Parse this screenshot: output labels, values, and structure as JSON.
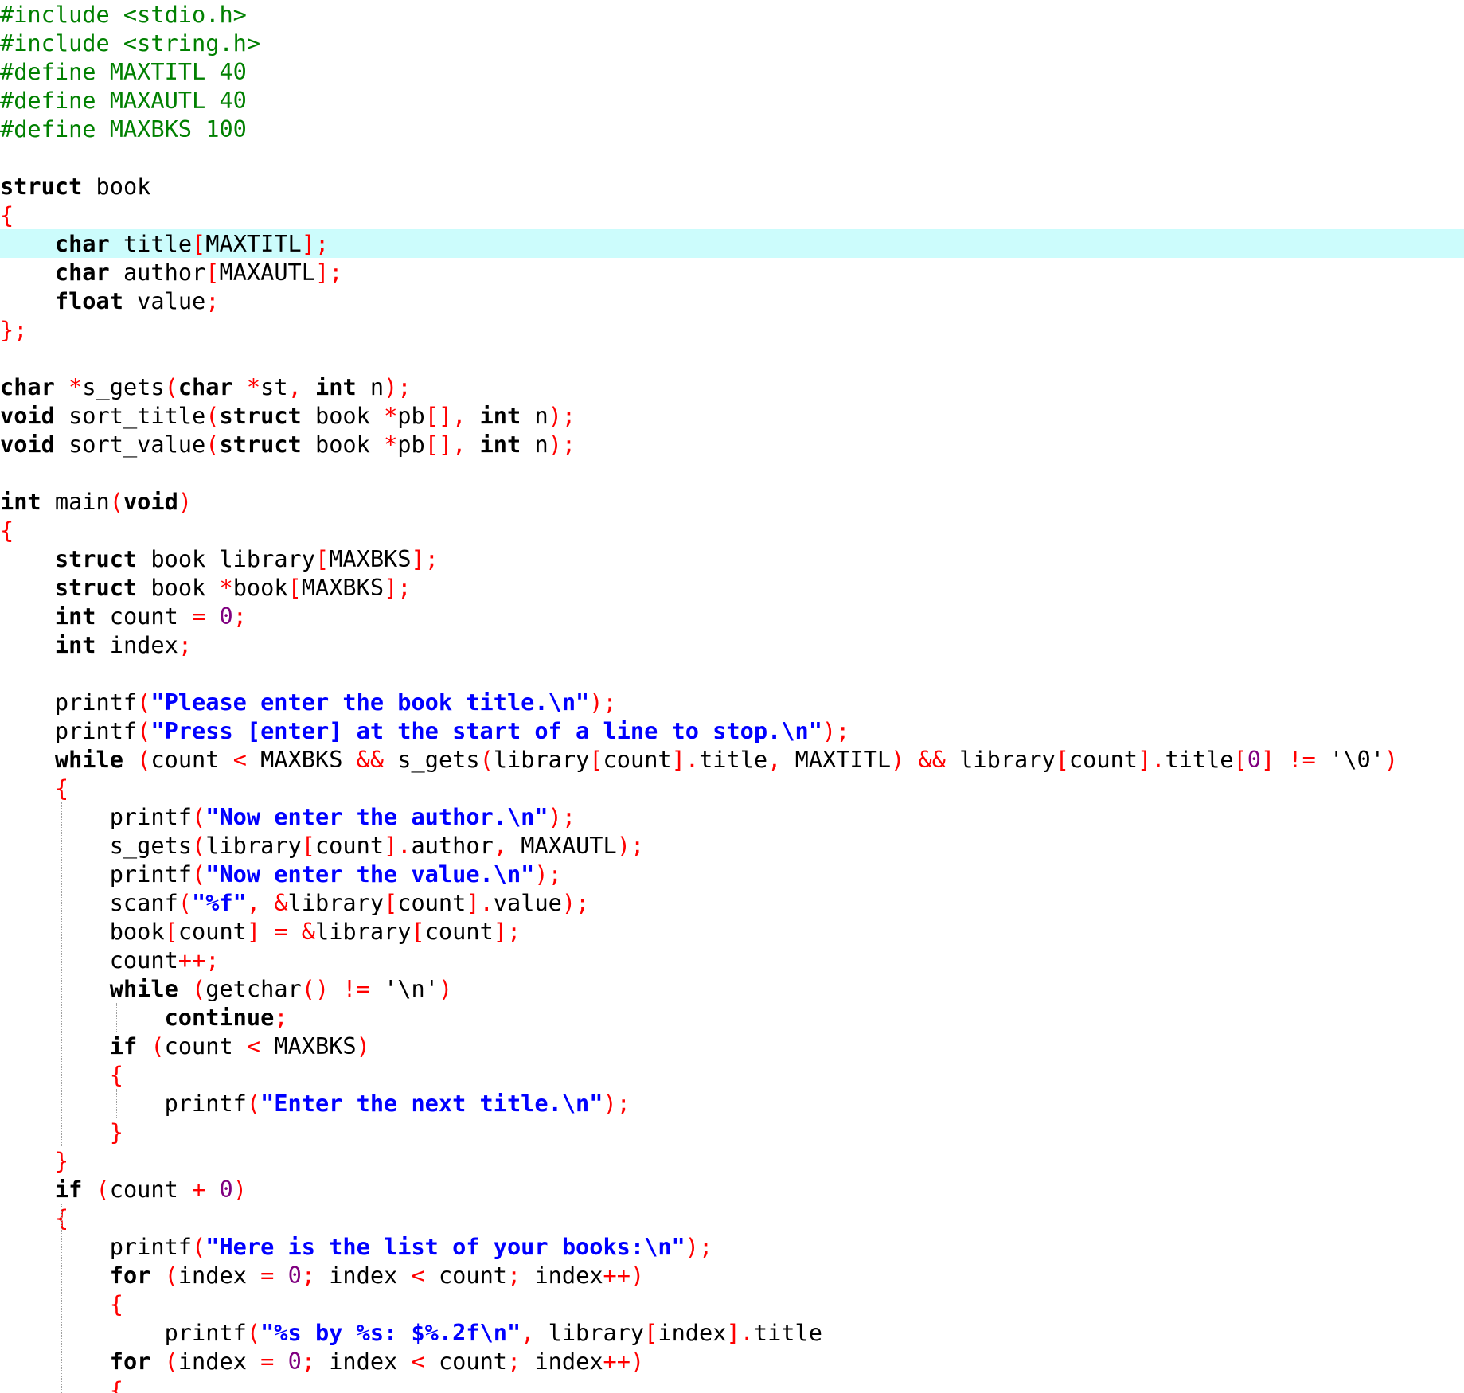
{
  "editor": {
    "current_line_index": 8,
    "colors": {
      "keyword": "#000000",
      "preprocessor": "#008000",
      "operator": "#ff0000",
      "string": "#0000ff",
      "number": "#800080",
      "current_line_highlight": "#ccfcfc"
    },
    "lines": [
      [
        [
          "#include <stdio.h>",
          "pp"
        ]
      ],
      [
        [
          "#include <string.h>",
          "pp"
        ]
      ],
      [
        [
          "#define MAXTITL 40",
          "pp"
        ]
      ],
      [
        [
          "#define MAXAUTL 40",
          "pp"
        ]
      ],
      [
        [
          "#define MAXBKS 100",
          "pp"
        ]
      ],
      [],
      [
        [
          "struct",
          "kw"
        ],
        [
          " book",
          ""
        ]
      ],
      [
        [
          "{",
          "op"
        ]
      ],
      [
        [
          "    ",
          ""
        ],
        [
          "char",
          "kw"
        ],
        [
          " title",
          ""
        ],
        [
          "[",
          "op"
        ],
        [
          "MAXTITL",
          ""
        ],
        [
          "];",
          "op"
        ]
      ],
      [
        [
          "    ",
          ""
        ],
        [
          "char",
          "kw"
        ],
        [
          " author",
          ""
        ],
        [
          "[",
          "op"
        ],
        [
          "MAXAUTL",
          ""
        ],
        [
          "];",
          "op"
        ]
      ],
      [
        [
          "    ",
          ""
        ],
        [
          "float",
          "kw"
        ],
        [
          " value",
          ""
        ],
        [
          ";",
          "op"
        ]
      ],
      [
        [
          "};",
          "op"
        ]
      ],
      [],
      [
        [
          "char",
          "kw"
        ],
        [
          " ",
          ""
        ],
        [
          "*",
          "op"
        ],
        [
          "s_gets",
          ""
        ],
        [
          "(",
          "op"
        ],
        [
          "char",
          "kw"
        ],
        [
          " ",
          ""
        ],
        [
          "*",
          "op"
        ],
        [
          "st",
          ""
        ],
        [
          ",",
          "op"
        ],
        [
          " ",
          ""
        ],
        [
          "int",
          "kw"
        ],
        [
          " n",
          ""
        ],
        [
          ");",
          "op"
        ]
      ],
      [
        [
          "void",
          "kw"
        ],
        [
          " sort_title",
          ""
        ],
        [
          "(",
          "op"
        ],
        [
          "struct",
          "kw"
        ],
        [
          " book ",
          ""
        ],
        [
          "*",
          "op"
        ],
        [
          "pb",
          ""
        ],
        [
          "[],",
          "op"
        ],
        [
          " ",
          ""
        ],
        [
          "int",
          "kw"
        ],
        [
          " n",
          ""
        ],
        [
          ");",
          "op"
        ]
      ],
      [
        [
          "void",
          "kw"
        ],
        [
          " sort_value",
          ""
        ],
        [
          "(",
          "op"
        ],
        [
          "struct",
          "kw"
        ],
        [
          " book ",
          ""
        ],
        [
          "*",
          "op"
        ],
        [
          "pb",
          ""
        ],
        [
          "[],",
          "op"
        ],
        [
          " ",
          ""
        ],
        [
          "int",
          "kw"
        ],
        [
          " n",
          ""
        ],
        [
          ");",
          "op"
        ]
      ],
      [],
      [
        [
          "int",
          "kw"
        ],
        [
          " main",
          ""
        ],
        [
          "(",
          "op"
        ],
        [
          "void",
          "kw"
        ],
        [
          ")",
          "op"
        ]
      ],
      [
        [
          "{",
          "op"
        ]
      ],
      [
        [
          "    ",
          ""
        ],
        [
          "struct",
          "kw"
        ],
        [
          " book library",
          ""
        ],
        [
          "[",
          "op"
        ],
        [
          "MAXBKS",
          ""
        ],
        [
          "];",
          "op"
        ]
      ],
      [
        [
          "    ",
          ""
        ],
        [
          "struct",
          "kw"
        ],
        [
          " book ",
          ""
        ],
        [
          "*",
          "op"
        ],
        [
          "book",
          ""
        ],
        [
          "[",
          "op"
        ],
        [
          "MAXBKS",
          ""
        ],
        [
          "];",
          "op"
        ]
      ],
      [
        [
          "    ",
          ""
        ],
        [
          "int",
          "kw"
        ],
        [
          " count ",
          ""
        ],
        [
          "=",
          "op"
        ],
        [
          " ",
          ""
        ],
        [
          "0",
          "num"
        ],
        [
          ";",
          "op"
        ]
      ],
      [
        [
          "    ",
          ""
        ],
        [
          "int",
          "kw"
        ],
        [
          " index",
          ""
        ],
        [
          ";",
          "op"
        ]
      ],
      [],
      [
        [
          "    printf",
          ""
        ],
        [
          "(",
          "op"
        ],
        [
          "\"Please enter the book title.\\n\"",
          "str"
        ],
        [
          ");",
          "op"
        ]
      ],
      [
        [
          "    printf",
          ""
        ],
        [
          "(",
          "op"
        ],
        [
          "\"Press [enter] at the start of a line to stop.\\n\"",
          "str"
        ],
        [
          ");",
          "op"
        ]
      ],
      [
        [
          "    ",
          ""
        ],
        [
          "while",
          "kw"
        ],
        [
          " ",
          ""
        ],
        [
          "(",
          "op"
        ],
        [
          "count ",
          ""
        ],
        [
          "<",
          "op"
        ],
        [
          " MAXBKS ",
          ""
        ],
        [
          "&&",
          "op"
        ],
        [
          " s_gets",
          ""
        ],
        [
          "(",
          "op"
        ],
        [
          "library",
          ""
        ],
        [
          "[",
          "op"
        ],
        [
          "count",
          ""
        ],
        [
          "].",
          "op"
        ],
        [
          "title",
          ""
        ],
        [
          ",",
          "op"
        ],
        [
          " MAXTITL",
          ""
        ],
        [
          ")",
          "op"
        ],
        [
          " ",
          ""
        ],
        [
          "&&",
          "op"
        ],
        [
          " library",
          ""
        ],
        [
          "[",
          "op"
        ],
        [
          "count",
          ""
        ],
        [
          "].",
          "op"
        ],
        [
          "title",
          ""
        ],
        [
          "[",
          "op"
        ],
        [
          "0",
          "num"
        ],
        [
          "]",
          "op"
        ],
        [
          " ",
          ""
        ],
        [
          "!=",
          "op"
        ],
        [
          " ",
          ""
        ],
        [
          "'\\0'",
          "ch"
        ],
        [
          ")",
          "op"
        ]
      ],
      [
        [
          "    ",
          ""
        ],
        [
          "{",
          "op"
        ]
      ],
      [
        [
          "        printf",
          ""
        ],
        [
          "(",
          "op"
        ],
        [
          "\"Now enter the author.\\n\"",
          "str"
        ],
        [
          ");",
          "op"
        ]
      ],
      [
        [
          "        s_gets",
          ""
        ],
        [
          "(",
          "op"
        ],
        [
          "library",
          ""
        ],
        [
          "[",
          "op"
        ],
        [
          "count",
          ""
        ],
        [
          "].",
          "op"
        ],
        [
          "author",
          ""
        ],
        [
          ",",
          "op"
        ],
        [
          " MAXAUTL",
          ""
        ],
        [
          ");",
          "op"
        ]
      ],
      [
        [
          "        printf",
          ""
        ],
        [
          "(",
          "op"
        ],
        [
          "\"Now enter the value.\\n\"",
          "str"
        ],
        [
          ");",
          "op"
        ]
      ],
      [
        [
          "        scanf",
          ""
        ],
        [
          "(",
          "op"
        ],
        [
          "\"%f\"",
          "str"
        ],
        [
          ",",
          "op"
        ],
        [
          " ",
          ""
        ],
        [
          "&",
          "op"
        ],
        [
          "library",
          ""
        ],
        [
          "[",
          "op"
        ],
        [
          "count",
          ""
        ],
        [
          "].",
          "op"
        ],
        [
          "value",
          ""
        ],
        [
          ");",
          "op"
        ]
      ],
      [
        [
          "        book",
          ""
        ],
        [
          "[",
          "op"
        ],
        [
          "count",
          ""
        ],
        [
          "]",
          "op"
        ],
        [
          " ",
          ""
        ],
        [
          "=",
          "op"
        ],
        [
          " ",
          ""
        ],
        [
          "&",
          "op"
        ],
        [
          "library",
          ""
        ],
        [
          "[",
          "op"
        ],
        [
          "count",
          ""
        ],
        [
          "];",
          "op"
        ]
      ],
      [
        [
          "        count",
          ""
        ],
        [
          "++;",
          "op"
        ]
      ],
      [
        [
          "        ",
          ""
        ],
        [
          "while",
          "kw"
        ],
        [
          " ",
          ""
        ],
        [
          "(",
          "op"
        ],
        [
          "getchar",
          ""
        ],
        [
          "()",
          "op"
        ],
        [
          " ",
          ""
        ],
        [
          "!=",
          "op"
        ],
        [
          " ",
          ""
        ],
        [
          "'\\n'",
          "ch"
        ],
        [
          ")",
          "op"
        ]
      ],
      [
        [
          "            ",
          ""
        ],
        [
          "continue",
          "kw"
        ],
        [
          ";",
          "op"
        ]
      ],
      [
        [
          "        ",
          ""
        ],
        [
          "if",
          "kw"
        ],
        [
          " ",
          ""
        ],
        [
          "(",
          "op"
        ],
        [
          "count ",
          ""
        ],
        [
          "<",
          "op"
        ],
        [
          " MAXBKS",
          ""
        ],
        [
          ")",
          "op"
        ]
      ],
      [
        [
          "        ",
          ""
        ],
        [
          "{",
          "op"
        ]
      ],
      [
        [
          "            printf",
          ""
        ],
        [
          "(",
          "op"
        ],
        [
          "\"Enter the next title.\\n\"",
          "str"
        ],
        [
          ");",
          "op"
        ]
      ],
      [
        [
          "        ",
          ""
        ],
        [
          "}",
          "op"
        ]
      ],
      [
        [
          "    ",
          ""
        ],
        [
          "}",
          "op"
        ]
      ],
      [
        [
          "    ",
          ""
        ],
        [
          "if",
          "kw"
        ],
        [
          " ",
          ""
        ],
        [
          "(",
          "op"
        ],
        [
          "count ",
          ""
        ],
        [
          "+",
          "op"
        ],
        [
          " ",
          ""
        ],
        [
          "0",
          "num"
        ],
        [
          ")",
          "op"
        ]
      ],
      [
        [
          "    ",
          ""
        ],
        [
          "{",
          "op"
        ]
      ],
      [
        [
          "        printf",
          ""
        ],
        [
          "(",
          "op"
        ],
        [
          "\"Here is the list of your books:\\n\"",
          "str"
        ],
        [
          ");",
          "op"
        ]
      ],
      [
        [
          "        ",
          ""
        ],
        [
          "for",
          "kw"
        ],
        [
          " ",
          ""
        ],
        [
          "(",
          "op"
        ],
        [
          "index ",
          ""
        ],
        [
          "=",
          "op"
        ],
        [
          " ",
          ""
        ],
        [
          "0",
          "num"
        ],
        [
          ";",
          "op"
        ],
        [
          " index ",
          ""
        ],
        [
          "<",
          "op"
        ],
        [
          " count",
          ""
        ],
        [
          ";",
          "op"
        ],
        [
          " index",
          ""
        ],
        [
          "++)",
          "op"
        ]
      ],
      [
        [
          "        ",
          ""
        ],
        [
          "{",
          "op"
        ]
      ],
      [
        [
          "            printf",
          ""
        ],
        [
          "(",
          "op"
        ],
        [
          "\"%s by %s: $%.2f\\n\"",
          "str"
        ],
        [
          ",",
          "op"
        ],
        [
          " library",
          ""
        ],
        [
          "[",
          "op"
        ],
        [
          "index",
          ""
        ],
        [
          "].",
          "op"
        ],
        [
          "title",
          ""
        ]
      ],
      [
        [
          "        ",
          ""
        ],
        [
          "for",
          "kw"
        ],
        [
          " ",
          ""
        ],
        [
          "(",
          "op"
        ],
        [
          "index ",
          ""
        ],
        [
          "=",
          "op"
        ],
        [
          " ",
          ""
        ],
        [
          "0",
          "num"
        ],
        [
          ";",
          "op"
        ],
        [
          " index ",
          ""
        ],
        [
          "<",
          "op"
        ],
        [
          " count",
          ""
        ],
        [
          ";",
          "op"
        ],
        [
          " index",
          ""
        ],
        [
          "++)",
          "op"
        ]
      ],
      [
        [
          "        ",
          ""
        ],
        [
          "{",
          "op"
        ]
      ]
    ]
  }
}
